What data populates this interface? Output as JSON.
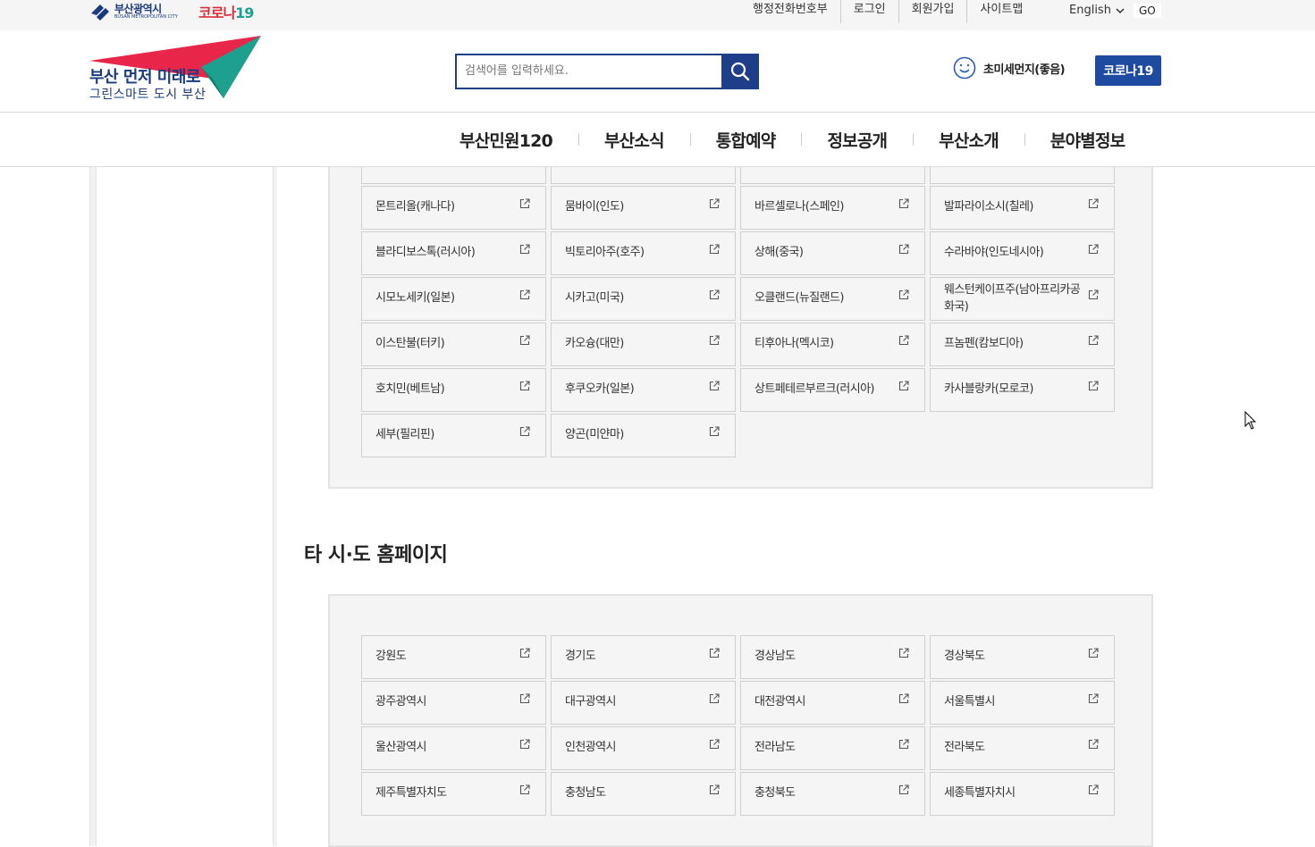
{
  "utility_bar": {
    "logo_ko": "부산광역시",
    "logo_en": "BUSAN METROPOLITAN CITY",
    "corona_logo_part1": "코로나",
    "corona_logo_part2": "19",
    "links": [
      "행정전화번호부",
      "로그인",
      "회원가입",
      "사이트맵"
    ],
    "language": "English",
    "go_label": "GO"
  },
  "header": {
    "slogan_line1": "부산 먼저 미래로",
    "slogan_line2": "그린스마트 도시 부산",
    "search_placeholder": "검색어를 입력하세요.",
    "air_quality": "초미세먼지(좋음)",
    "corona_button": "코로나19"
  },
  "gnb": {
    "items": [
      "부산민원120",
      "부산소식",
      "통합예약",
      "정보공개",
      "부산소개",
      "분야별정보"
    ]
  },
  "sister_cities": {
    "tiles": [
      "몬트리올(캐나다)",
      "뭄바이(인도)",
      "바르셀로나(스페인)",
      "발파라이소시(칠레)",
      "블라디보스톡(러시아)",
      "빅토리아주(호주)",
      "상해(중국)",
      "수라바야(인도네시아)",
      "시모노세키(일본)",
      "시카고(미국)",
      "오클랜드(뉴질랜드)",
      "웨스턴케이프주(남아프리카공화국)",
      "이스탄불(터키)",
      "카오슝(대만)",
      "티후아나(멕시코)",
      "프놈펜(캄보디아)",
      "호치민(베트남)",
      "후쿠오카(일본)",
      "상트페테르부르크(러시아)",
      "카사블랑카(모로코)",
      "세부(필리핀)",
      "양곤(미얀마)"
    ]
  },
  "other_cities": {
    "title": "타 시·도 홈페이지",
    "tiles": [
      "강원도",
      "경기도",
      "경상남도",
      "경상북도",
      "광주광역시",
      "대구광역시",
      "대전광역시",
      "서울특별시",
      "울산광역시",
      "인천광역시",
      "전라남도",
      "전라북도",
      "제주특별자치도",
      "충청남도",
      "충청북도",
      "세종특별자치시"
    ]
  },
  "colors": {
    "brand_blue": "#1e3e8a",
    "corona_blue": "#1e4aa0",
    "logo_red": "#e8264a",
    "logo_green": "#1ea08f"
  }
}
